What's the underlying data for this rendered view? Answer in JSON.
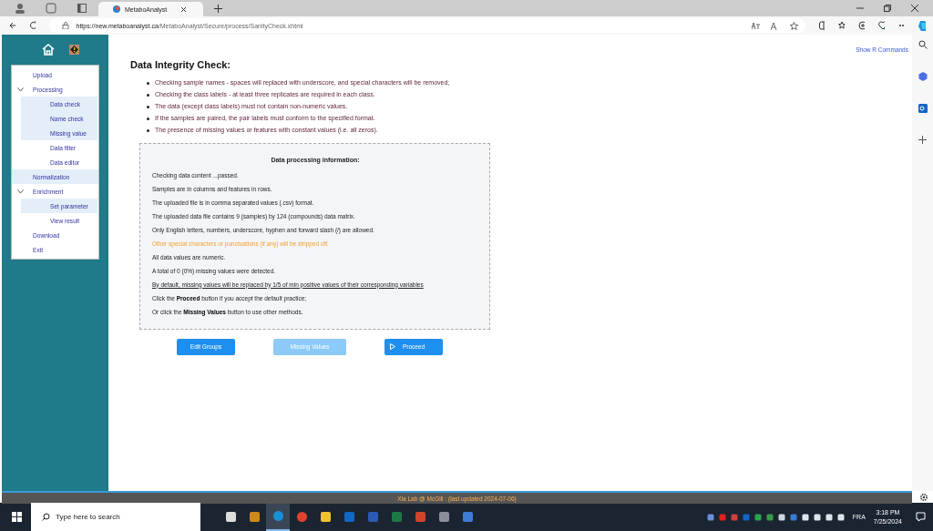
{
  "browser": {
    "tab_title": "MetaboAnalyst",
    "url_host": "https://new.metaboanalyst.ca",
    "url_path": "/MetaboAnalyst/Secure/process/SanityCheck.xhtml"
  },
  "sidebar": {
    "items": [
      {
        "label": "Upload",
        "highlighted": false
      },
      {
        "label": "Processing",
        "highlighted": false,
        "expanded": true,
        "children": [
          {
            "label": "Data check",
            "highlighted": true
          },
          {
            "label": "Name check",
            "highlighted": true
          },
          {
            "label": "Missing value",
            "highlighted": true
          },
          {
            "label": "Data filter",
            "highlighted": false
          },
          {
            "label": "Data editor",
            "highlighted": false
          }
        ]
      },
      {
        "label": "Normalization",
        "highlighted": true
      },
      {
        "label": "Enrichment",
        "highlighted": false,
        "expanded": true,
        "children": [
          {
            "label": "Set parameter",
            "highlighted": true
          },
          {
            "label": "View result",
            "highlighted": false
          }
        ]
      },
      {
        "label": "Download",
        "highlighted": false
      },
      {
        "label": "Exit",
        "highlighted": false
      }
    ]
  },
  "show_r_commands": "Show R Commands",
  "title": "Data Integrity Check:",
  "bullets": [
    "Checking sample names - spaces will replaced with underscore, and special characters will be removed;",
    "Checking the class labels - at least three replicates are required in each class.",
    "The data (except class labels) must not contain non-numeric values.",
    "If the samples are paired, the pair labels must conform to the specified format.",
    "The presence of missing values or features with constant values (i.e. all zeros)."
  ],
  "info": {
    "heading": "Data processing information:",
    "lines": [
      {
        "text": "Checking data content ...passed.",
        "kind": "plain"
      },
      {
        "text": "Samples are in columns and features in rows.",
        "kind": "plain"
      },
      {
        "text": "The uploaded file is in comma separated values (.csv) format.",
        "kind": "plain"
      },
      {
        "text": "The uploaded data file contains 9 (samples) by 124 (compounds) data matrix.",
        "kind": "plain"
      },
      {
        "text": "Only English letters, numbers, underscore, hyphen and forward slash (/) are allowed.",
        "kind": "plain"
      },
      {
        "text": "Other special characters or punctuations (if any) will be stripped off.",
        "kind": "warning"
      },
      {
        "text": "All data values are numeric.",
        "kind": "plain"
      },
      {
        "text": "A total of 0 (0%) missing values were detected.",
        "kind": "plain"
      },
      {
        "text": "By default, missing values will be replaced by 1/5 of min positive values of their corresponding variables",
        "kind": "underlined"
      },
      {
        "text": "Click the **Proceed** button if you accept the default practice;",
        "kind": "plain"
      },
      {
        "text": "Or click the **Missing Values** button to use other methods.",
        "kind": "plain"
      }
    ]
  },
  "buttons": [
    {
      "label": "Edit Groups",
      "disabled": false,
      "kind": "plain"
    },
    {
      "label": "Missing Values",
      "disabled": true,
      "kind": "plain"
    },
    {
      "label": "Proceed",
      "disabled": false,
      "kind": "play"
    }
  ],
  "footer": "Xia Lab @ McGill : (last updated 2024-07-06)",
  "taskbar": {
    "search_placeholder": "Type here to search",
    "language": "FRA",
    "time": "3:18 PM",
    "date": "7/25/2024"
  }
}
